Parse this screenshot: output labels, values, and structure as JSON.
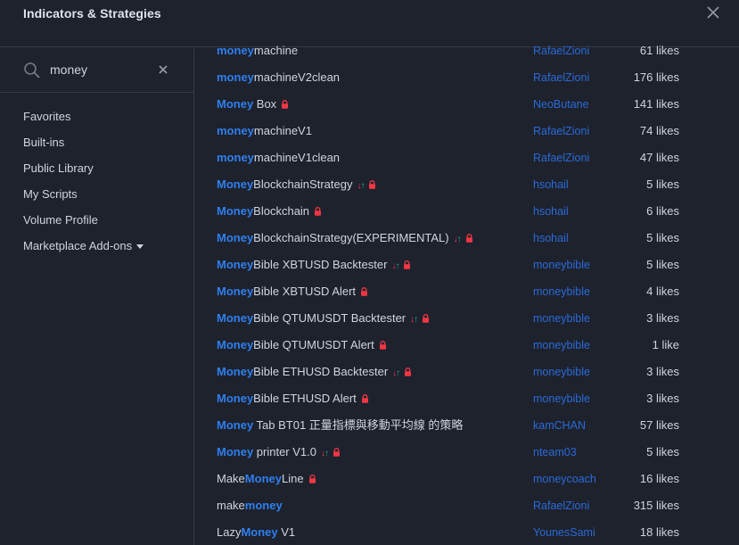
{
  "header": {
    "title": "Indicators & Strategies"
  },
  "search": {
    "value": "money"
  },
  "nav": {
    "items": [
      {
        "label": "Favorites"
      },
      {
        "label": "Built-ins"
      },
      {
        "label": "Public Library"
      },
      {
        "label": "My Scripts"
      },
      {
        "label": "Volume Profile"
      },
      {
        "label": "Marketplace Add-ons"
      }
    ]
  },
  "results": [
    {
      "hl": "money",
      "rest": "machine",
      "author": "RafaelZioni",
      "likes": "61 likes",
      "arrows": false,
      "lock": false
    },
    {
      "hl": "money",
      "rest": "machineV2clean",
      "author": "RafaelZioni",
      "likes": "176 likes",
      "arrows": false,
      "lock": false
    },
    {
      "hl": "Money",
      "rest": " Box",
      "author": "NeoButane",
      "likes": "141 likes",
      "arrows": false,
      "lock": true
    },
    {
      "hl": "money",
      "rest": "machineV1",
      "author": "RafaelZioni",
      "likes": "74 likes",
      "arrows": false,
      "lock": false
    },
    {
      "hl": "money",
      "rest": "machineV1clean",
      "author": "RafaelZioni",
      "likes": "47 likes",
      "arrows": false,
      "lock": false
    },
    {
      "hl": "Money",
      "rest": "BlockchainStrategy",
      "author": "hsohail",
      "likes": "5 likes",
      "arrows": true,
      "lock": true
    },
    {
      "hl": "Money",
      "rest": "Blockchain",
      "author": "hsohail",
      "likes": "6 likes",
      "arrows": false,
      "lock": true
    },
    {
      "hl": "Money",
      "rest": "BlockchainStrategy(EXPERIMENTAL)",
      "author": "hsohail",
      "likes": "5 likes",
      "arrows": true,
      "lock": true
    },
    {
      "hl": "Money",
      "rest": "Bible XBTUSD Backtester",
      "author": "moneybible",
      "likes": "5 likes",
      "arrows": true,
      "lock": true
    },
    {
      "hl": "Money",
      "rest": "Bible XBTUSD Alert",
      "author": "moneybible",
      "likes": "4 likes",
      "arrows": false,
      "lock": true
    },
    {
      "hl": "Money",
      "rest": "Bible QTUMUSDT Backtester",
      "author": "moneybible",
      "likes": "3 likes",
      "arrows": true,
      "lock": true
    },
    {
      "hl": "Money",
      "rest": "Bible QTUMUSDT Alert",
      "author": "moneybible",
      "likes": "1 like",
      "arrows": false,
      "lock": true
    },
    {
      "hl": "Money",
      "rest": "Bible ETHUSD Backtester",
      "author": "moneybible",
      "likes": "3 likes",
      "arrows": true,
      "lock": true
    },
    {
      "hl": "Money",
      "rest": "Bible ETHUSD Alert",
      "author": "moneybible",
      "likes": "3 likes",
      "arrows": false,
      "lock": true
    },
    {
      "hl": "Money",
      "rest": " Tab BT01 正量指標與移動平均線 的策略",
      "author": "kamCHAN",
      "likes": "57 likes",
      "arrows": false,
      "lock": false
    },
    {
      "hl": "Money",
      "rest": " printer V1.0",
      "author": "nteam03",
      "likes": "5 likes",
      "arrows": true,
      "lock": true
    },
    {
      "pre": "Make",
      "hl": "Money",
      "rest": "Line",
      "author": "moneycoach",
      "likes": "16 likes",
      "arrows": false,
      "lock": true
    },
    {
      "pre": "make",
      "hl": "money",
      "rest": "",
      "author": "RafaelZioni",
      "likes": "315 likes",
      "arrows": false,
      "lock": false
    },
    {
      "pre": "Lazy",
      "hl": "Money",
      "rest": " V1",
      "author": "YounesSami",
      "likes": "18 likes",
      "arrows": false,
      "lock": false
    }
  ]
}
